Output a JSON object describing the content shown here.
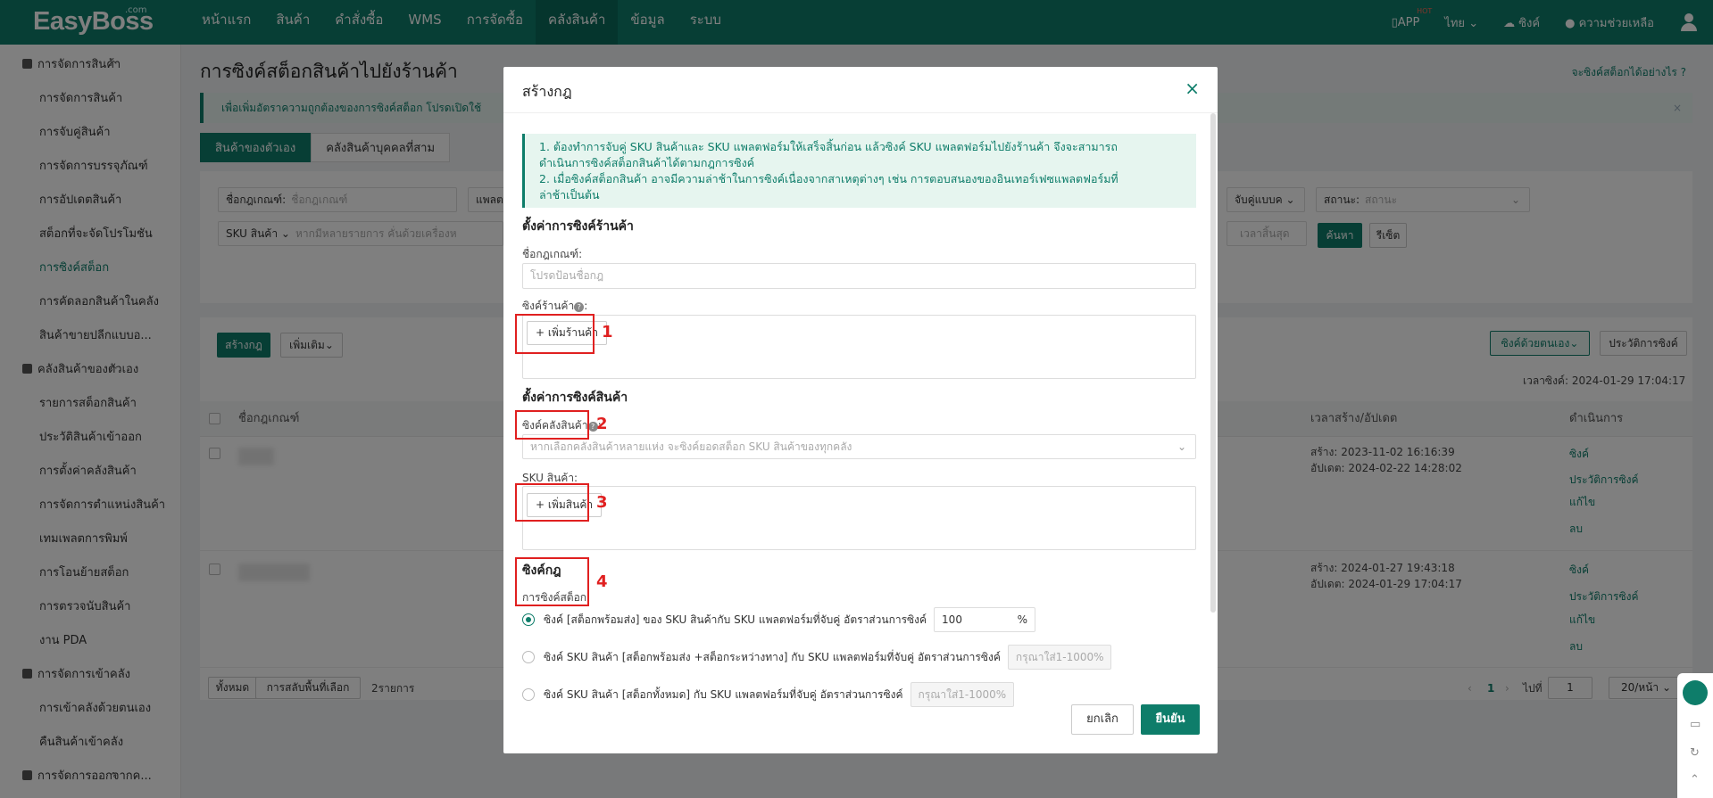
{
  "topbar": {
    "logo": "EasyBoss",
    "logo_com": ".com",
    "nav": [
      "หน้าแรก",
      "สินค้า",
      "คำสั่งซื้อ",
      "WMS",
      "การจัดซื้อ",
      "คลังสินค้า",
      "ข้อมูล",
      "ระบบ"
    ],
    "active_nav": "คลังสินค้า",
    "app": "APP",
    "hot": "HOT",
    "lang": "ไทย",
    "sync": "ซิงค์",
    "help": "ความช่วยเหลือ"
  },
  "sidebar": {
    "group1": "การจัดการสินค้า",
    "group1_items": [
      "การจัดการสินค้า",
      "การจับคู่สินค้า",
      "การจัดการบรรจุภัณฑ์",
      "การอัปเดตสินค้า",
      "สต็อกที่จะจัดโปรโมชัน",
      "การซิงค์สต็อก",
      "การคัดลอกสินค้าในคลัง",
      "สินค้าขายปลีกแบบอ..."
    ],
    "group2": "คลังสินค้าของตัวเอง",
    "group2_items": [
      "รายการสต็อกสินค้า",
      "ประวัติสินค้าเข้าออก",
      "การตั้งค่าคลังสินค้า",
      "การจัดการตำแหน่งสินค้า",
      "เทมเพลตการพิมพ์",
      "การโอนย้ายสต็อก",
      "การตรวจนับสินค้า",
      "งาน PDA"
    ],
    "group3": "การจัดการเข้าคลัง",
    "group3_items": [
      "การเข้าคลังด้วยตนเอง",
      "คืนสินค้าเข้าคลัง"
    ],
    "group4": "การจัดการออกจากค..."
  },
  "page": {
    "title": "การซิงค์สต็อกสินค้าไปยังร้านค้า",
    "help_link": "จะซิงค์สต็อกได้อย่างไร ?",
    "banner": "เพื่อเพิ่มอัตราความถูกต้องของการซิงค์สต็อก โปรดเปิดใช้",
    "tabs": [
      "สินค้าของตัวเอง",
      "คลังสินค้าบุคคลที่สาม"
    ],
    "filter_rule_label": "ชื่อกฎเกณฑ์:",
    "filter_rule_ph": "ชื่อกฎเกณฑ์",
    "filter_platform": "แพลตฟ",
    "filter_match": "จับคู่แบบค",
    "filter_status_label": "สถานะ:",
    "filter_status_ph": "สถานะ",
    "filter_sku": "SKU สินค้า",
    "filter_sku_ph": "หากมีหลายรายการ คั่นด้วยเครื่องห",
    "filter_date_ph": "เวลาสิ้นสุด",
    "search_btn": "ค้นหา",
    "reset_btn": "รีเซ็ต",
    "create_rule_btn": "สร้างกฎ",
    "more_btn": "เพิ่มเติม",
    "sync_manual_btn": "ซิงค์ด้วยตนเอง",
    "sync_history_btn": "ประวัติการซิงค์",
    "sync_time_label": "เวลาซิงค์:",
    "sync_time": "2024-01-29 17:04:17",
    "col_rule": "ชื่อกฎเกณฑ์",
    "col_time": "เวลาสร้าง/อัปเดต",
    "col_action": "ดำเนินการ",
    "rows": [
      {
        "created_label": "สร้าง:",
        "created": "2023-11-02 16:16:39",
        "updated_label": "อัปเดต:",
        "updated": "2024-02-22 14:28:02",
        "actions": [
          "ซิงค์",
          "ประวัติการซิงค์",
          "แก้ไข",
          "ลบ"
        ]
      },
      {
        "created_label": "สร้าง:",
        "created": "2024-01-27 19:43:18",
        "updated_label": "อัปเดต:",
        "updated": "2024-01-29 17:04:17",
        "actions": [
          "ซิงค์",
          "ประวัติการซิงค์",
          "แก้ไข",
          "ลบ"
        ]
      }
    ],
    "pager_all": "ทั้งหมด",
    "pager_switch": "การสลับพื้นที่เลือก",
    "pager_count": "2รายการ",
    "pager_page": "1",
    "pager_goto": "ไปที่",
    "pager_input": "1",
    "pager_size": "20/หน้า"
  },
  "modal": {
    "title": "สร้างกฎ",
    "notice_1": "1. ต้องทำการจับคู่ SKU สินค้าและ SKU แพลตฟอร์มให้เสร็จสิ้นก่อน แล้วซิงค์ SKU แพลตฟอร์มไปยังร้านค้า จึงจะสามารถ",
    "notice_1b": "ดำเนินการซิงค์สต็อกสินค้าได้ตามกฎการซิงค์",
    "notice_2": "2. เมื่อซิงค์สต็อกสินค้า อาจมีความล่าช้าในการซิงค์เนื่องจากสาเหตุต่างๆ เช่น การตอบสนองของอินเทอร์เฟซแพลตฟอร์มที่",
    "notice_2b": "ล่าช้าเป็นต้น",
    "store_section": "ตั้งค่าการซิงค์ร้านค้า",
    "rule_name_label": "ชื่อกฎเกณฑ์:",
    "rule_name_ph": "โปรดป้อนชื่อกฎ",
    "sync_store_label": "ซิงค์ร้านค้า",
    "add_store_btn": "+ เพิ่มร้านค้า",
    "product_section": "ตั้งค่าการซิงค์สินค้า",
    "sync_warehouse_label": "ซิงค์คลังสินค้า",
    "warehouse_ph": "หากเลือกคลังสินค้าหลายแห่ง จะซิงค์ยอดสต็อก SKU สินค้าของทุกคลัง",
    "sku_label": "SKU สินค้า:",
    "add_product_btn": "+ เพิ่มสินค้า",
    "rule_section": "ซิงค์กฎ",
    "stock_sync_label": "การซิงค์สต็อก:",
    "opt1": "ซิงค์ [สต็อกพร้อมส่ง] ของ SKU สินค้ากับ SKU แพลตฟอร์มที่จับคู่ อัตราส่วนการซิงค์",
    "opt1_value": "100",
    "percent": "%",
    "opt2": "ซิงค์ SKU สินค้า [สต็อกพร้อมส่ง +สต็อกระหว่างทาง] กับ SKU แพลตฟอร์มที่จับคู่  อัตราส่วนการซิงค์",
    "opt2_ph": "กรุณาใส่1-1000",
    "opt3": "ซิงค์ SKU สินค้า  [สต็อกทั้งหมด] กับ SKU แพลตฟอร์มที่จับคู่  อัตราส่วนการซิงค์",
    "opt3_ph": "กรุณาใส่1-1000",
    "cancel_btn": "ยกเลิก",
    "confirm_btn": "ยืนยัน",
    "markers": [
      "1",
      "2",
      "3",
      "4"
    ]
  }
}
